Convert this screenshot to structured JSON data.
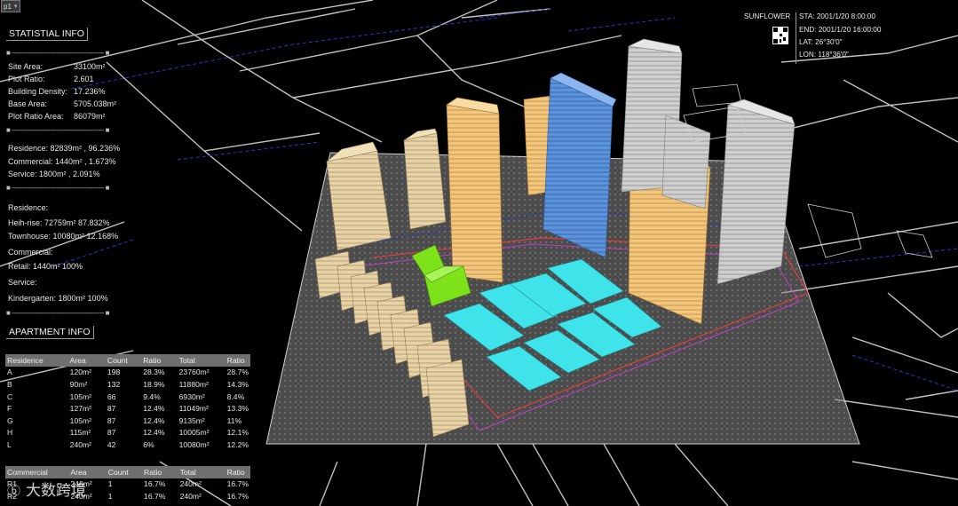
{
  "toolbar": {
    "page_label": "p1"
  },
  "stats": {
    "header": "STATISTIAL INFO",
    "lines": [
      {
        "k": "Site Area:",
        "v": "33100m²"
      },
      {
        "k": "Plot Ratio:",
        "v": "2.601"
      },
      {
        "k": "Building Density:",
        "v": "17.236%"
      },
      {
        "k": "Base Area:",
        "v": "5705.038m²"
      },
      {
        "k": "Plot Ratio Area:",
        "v": "86079m²"
      }
    ],
    "usage": [
      "Residence:  82839m² , 96.236%",
      "Commercial:  1440m² , 1.673%",
      "Service:  1800m² , 2.091%"
    ],
    "breakdown": [
      "Residence:",
      "Heih-rise:  72759m²  87.832%",
      "Townhouse:  10080m²  12.168%",
      "Commercial:",
      "Retail:  1440m²  100%",
      "Service:",
      "Kindergarten:  1800m²  100%"
    ]
  },
  "apartment": {
    "header": "APARTMENT INFO",
    "columns": [
      "Residence",
      "Area",
      "Count",
      "Ratio",
      "Total",
      "Ratio"
    ],
    "rows": [
      [
        "A",
        "120m²",
        "198",
        "28.3%",
        "23760m²",
        "28.7%"
      ],
      [
        "B",
        "90m²",
        "132",
        "18.9%",
        "11880m²",
        "14.3%"
      ],
      [
        "C",
        "105m²",
        "66",
        "9.4%",
        "6930m²",
        "8.4%"
      ],
      [
        "F",
        "127m²",
        "87",
        "12.4%",
        "11049m²",
        "13.3%"
      ],
      [
        "G",
        "105m²",
        "87",
        "12.4%",
        "9135m²",
        "11%"
      ],
      [
        "H",
        "115m²",
        "87",
        "12.4%",
        "10005m²",
        "12.1%"
      ],
      [
        "L",
        "240m²",
        "42",
        "6%",
        "10080m²",
        "12.2%"
      ]
    ],
    "commercial_columns": [
      "Commercial",
      "Area",
      "Count",
      "Ratio",
      "Total",
      "Ratio"
    ],
    "commercial_rows": [
      [
        "R1",
        "240m²",
        "1",
        "16.7%",
        "240m²",
        "16.7%"
      ],
      [
        "R2",
        "240m²",
        "1",
        "16.7%",
        "240m²",
        "16.7%"
      ]
    ]
  },
  "sun": {
    "title": "SUNFLOWER",
    "sta": "STA: 2001/1/20 8:00:00",
    "end": "END: 2001/1/20 16:00:00",
    "lat": "LAT: 26°30'0\"",
    "lon": "LON: 118°36'0\""
  },
  "watermark": "大数跨境",
  "colors": {
    "tower_orange": "#f2c77d",
    "tower_blue": "#5b93dc",
    "tower_grey": "#c9c9c9",
    "townhouse_tan": "#e7d3a6",
    "commercial_cyan": "#3fe3ea",
    "kindergarten_green": "#7ee21a",
    "site_plane": "#8a8a8a",
    "boundary_red": "#e23c3c",
    "road_blue": "#2b36c8"
  }
}
